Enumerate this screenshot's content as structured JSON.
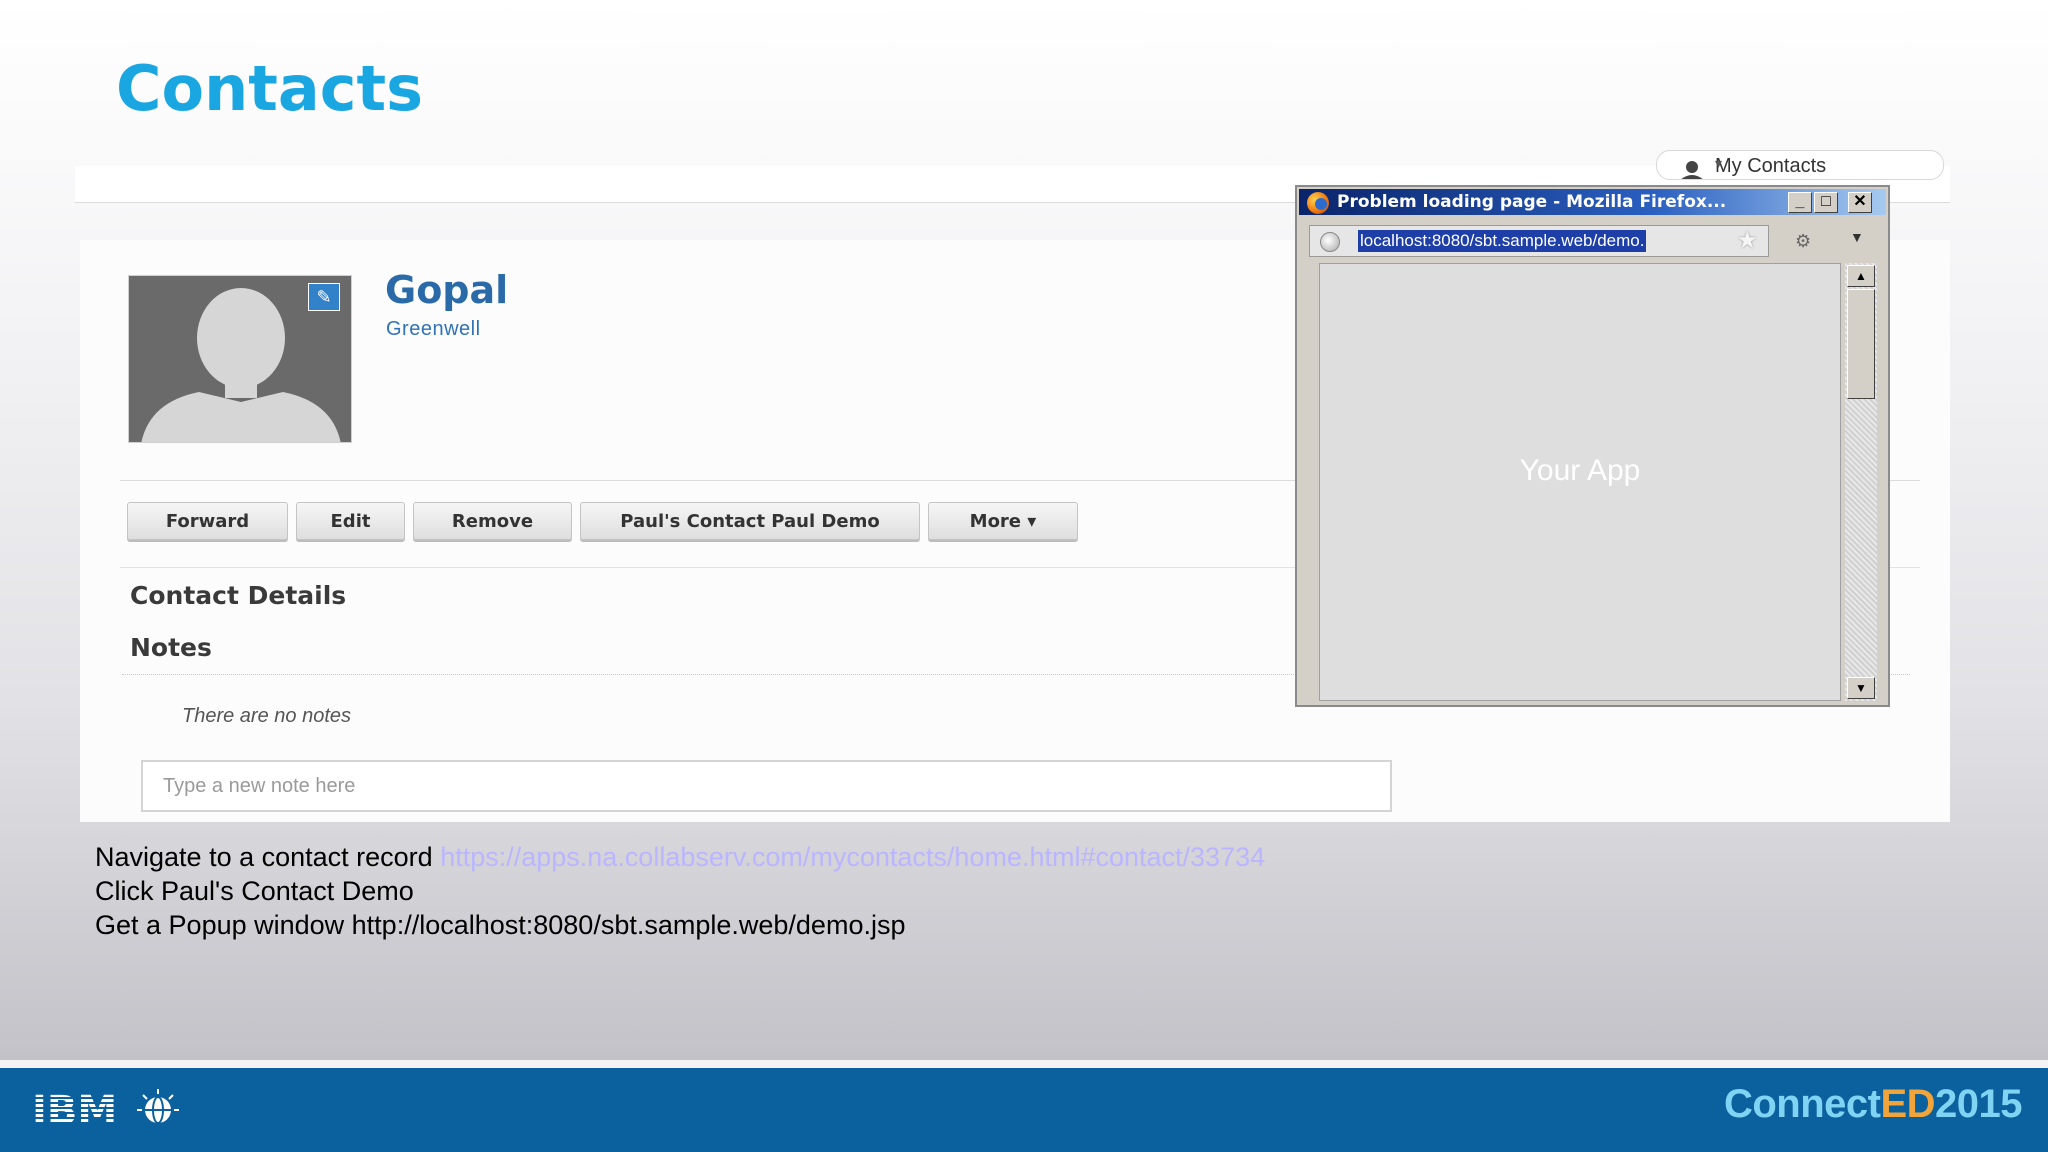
{
  "slide": {
    "title": "Contacts"
  },
  "app": {
    "my_contacts_label": "My Contacts",
    "contact": {
      "first_name": "Gopal",
      "last_name": "Greenwell"
    },
    "actions": {
      "forward": "Forward",
      "edit": "Edit",
      "remove": "Remove",
      "custom": "Paul's Contact Paul Demo",
      "more": "More ▾"
    },
    "sections": {
      "details": "Contact Details",
      "notes": "Notes"
    },
    "notes": {
      "empty_text": "There are no notes",
      "input_placeholder": "Type a new note here"
    }
  },
  "popup": {
    "title": "Problem loading page - Mozilla Firefox...",
    "url": "localhost:8080/sbt.sample.web/demo.",
    "content_text": "Your App",
    "controls": {
      "minimize": "_",
      "maximize": "□",
      "close": "✕"
    }
  },
  "caption": {
    "line1_text": "Navigate to a contact record ",
    "line1_link": "https://apps.na.collabserv.com/mycontacts/home.html#contact/33734",
    "line2": "Click Paul's Contact Demo",
    "line3": "Get a Popup window http://localhost:8080/sbt.sample.web/demo.jsp"
  },
  "footer": {
    "brand": "IBM",
    "event_part1": "Connect",
    "event_part2": "ED",
    "event_part3": "2015"
  },
  "colors": {
    "title": "#1aa7e1",
    "footer_bg": "#0b609e",
    "link": "#b9b6ff",
    "ed_orange": "#f0a43a",
    "connect_blue": "#7fd4f4"
  },
  "icons": {
    "edit_photo": "pencil-icon",
    "avatar": "person-silhouette-icon",
    "browser": "firefox-icon",
    "site": "globe-icon",
    "bookmark": "star-icon"
  }
}
